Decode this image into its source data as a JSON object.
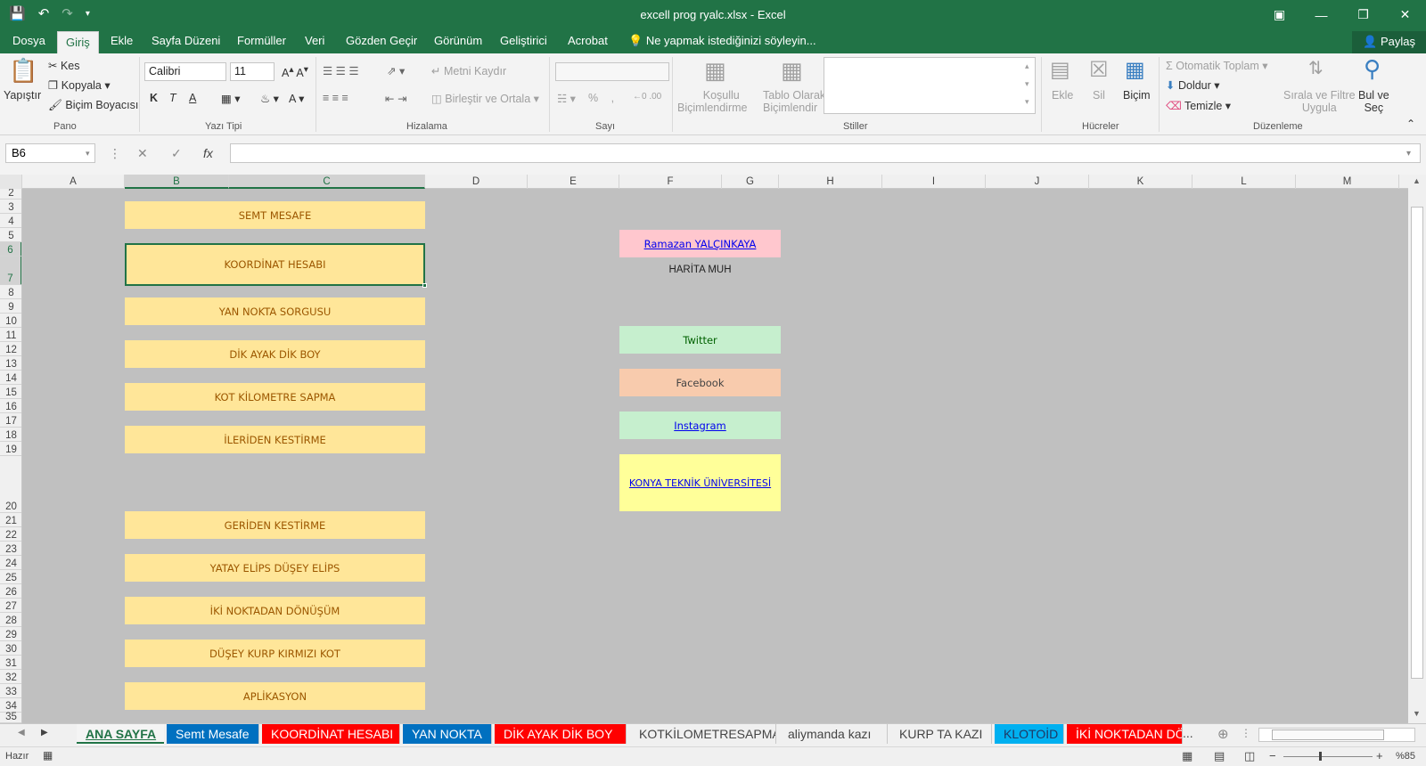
{
  "window": {
    "title": "excell prog ryalc.xlsx - Excel"
  },
  "ribbon_tabs": [
    "Dosya",
    "Giriş",
    "Ekle",
    "Sayfa Düzeni",
    "Formüller",
    "Veri",
    "Gözden Geçir",
    "Görünüm",
    "Geliştirici",
    "Acrobat"
  ],
  "active_tab": "Giriş",
  "tell_me": "Ne yapmak istediğinizi söyleyin...",
  "share": "Paylaş",
  "clipboard": {
    "paste": "Yapıştır",
    "cut": "Kes",
    "copy": "Kopyala",
    "format_painter": "Biçim Boyacısı",
    "group": "Pano"
  },
  "font": {
    "name": "Calibri",
    "size": "11",
    "group": "Yazı Tipi",
    "bold": "K",
    "italic": "T",
    "underline": "A"
  },
  "alignment": {
    "wrap": "Metni Kaydır",
    "merge": "Birleştir ve Ortala",
    "group": "Hizalama"
  },
  "number": {
    "group": "Sayı",
    "percent": "%"
  },
  "styles": {
    "conditional_1": "Koşullu",
    "conditional_2": "Biçimlendirme",
    "table_1": "Tablo Olarak",
    "table_2": "Biçimlendir",
    "group": "Stiller"
  },
  "cells": {
    "insert": "Ekle",
    "delete": "Sil",
    "format": "Biçim",
    "group": "Hücreler"
  },
  "editing": {
    "autosum": "Otomatik Toplam",
    "fill": "Doldur",
    "clear": "Temizle",
    "sort_1": "Sırala ve Filtre",
    "sort_2": "Uygula",
    "find_1": "Bul ve",
    "find_2": "Seç",
    "group": "Düzenleme"
  },
  "name_box": "B6",
  "columns": [
    "A",
    "B",
    "C",
    "D",
    "E",
    "F",
    "G",
    "H",
    "I",
    "J",
    "K",
    "L",
    "M"
  ],
  "rows": [
    "2",
    "3",
    "4",
    "5",
    "6",
    "7",
    "8",
    "9",
    "10",
    "11",
    "12",
    "13",
    "14",
    "15",
    "16",
    "17",
    "18",
    "19",
    "20",
    "21",
    "22",
    "23",
    "24",
    "25",
    "26",
    "27",
    "28",
    "29",
    "30",
    "31",
    "32",
    "33",
    "34",
    "35"
  ],
  "menu_buttons": [
    "SEMT MESAFE",
    "KOORDİNAT HESABI",
    "YAN NOKTA SORGUSU",
    "DİK AYAK DİK BOY",
    "KOT KİLOMETRE SAPMA",
    "İLERİDEN KESTİRME",
    "GERİDEN KESTİRME",
    "YATAY ELİPS DÜŞEY ELİPS",
    "İKİ NOKTADAN DÖNÜŞÜM",
    "DÜŞEY KURP KIRMIZI KOT",
    "APLİKASYON"
  ],
  "author": {
    "name": "Ramazan YALÇINKAYA",
    "title": "HARİTA MUH"
  },
  "social": {
    "twitter": "Twitter",
    "facebook": "Facebook",
    "instagram": "Instagram",
    "university": "KONYA TEKNİK ÜNİVERSİTESİ"
  },
  "sheet_tabs": [
    {
      "name": "ANA SAYFA",
      "bg": "#f4f4f4",
      "color": "#217346"
    },
    {
      "name": "Semt Mesafe",
      "bg": "#0070c0",
      "color": "#ffffff"
    },
    {
      "name": "KOORDİNAT HESABI",
      "bg": "#ff0000",
      "color": "#ffffff"
    },
    {
      "name": "YAN NOKTA",
      "bg": "#0070c0",
      "color": "#ffffff"
    },
    {
      "name": "DİK AYAK DİK BOY",
      "bg": "#ff0000",
      "color": "#ffffff"
    },
    {
      "name": "KOTKİLOMETRESAPMA",
      "bg": "#f0f0f0",
      "color": "#444444"
    },
    {
      "name": "aliymanda kazı",
      "bg": "#f0f0f0",
      "color": "#444444"
    },
    {
      "name": "KURP TA KAZI",
      "bg": "#f0f0f0",
      "color": "#444444"
    },
    {
      "name": "KLOTOİD",
      "bg": "#00b0f0",
      "color": "#1f3864"
    },
    {
      "name": "İKİ NOKTADAN DÖN",
      "bg": "#ff0000",
      "color": "#ffffff"
    }
  ],
  "more_tabs": "...",
  "status": {
    "ready": "Hazır",
    "zoom": "%85"
  },
  "colors": {
    "excel_green": "#217346",
    "button_yellow": "#ffe699",
    "button_text": "#9c5700"
  }
}
